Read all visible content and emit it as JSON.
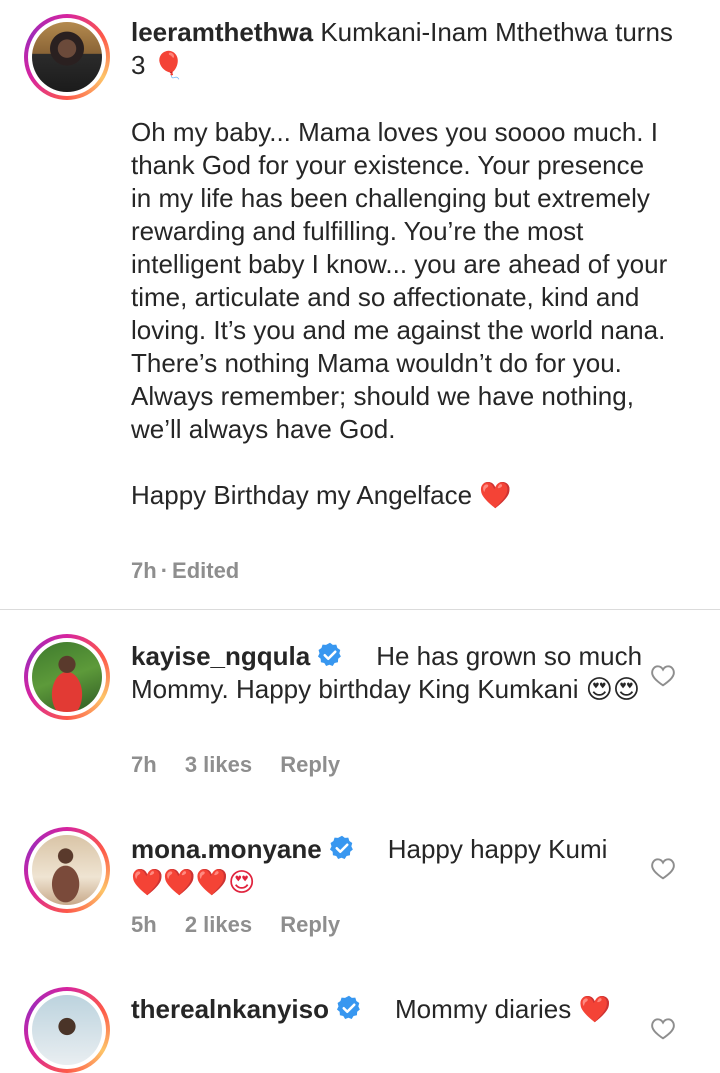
{
  "post": {
    "username": "leeramthethwa",
    "title_text": "Kumkani-Inam Mthethwa turns 3",
    "title_emoji": "🎈",
    "body": "Oh my baby... Mama loves you soooo much. I thank God for your existence. Your presence in my life has been challenging but extremely rewarding and fulfilling. You’re the most intelligent baby I know... you are ahead of your time, articulate and so affectionate, kind and loving. It’s you and me against the world nana. There’s nothing Mama wouldn’t do for you. Always remember; should we have nothing, we’ll always have God.",
    "closing": "Happy Birthday my Angelface",
    "closing_emoji": "❤️",
    "time": "7h",
    "edited": "Edited",
    "separator": "·"
  },
  "comments": [
    {
      "username": "kayise_ngqula",
      "verified": true,
      "text": "He has grown so much Mommy. Happy birthday King Kumkani",
      "emoji": "😍😍",
      "time": "7h",
      "likes": "3 likes",
      "reply": "Reply"
    },
    {
      "username": "mona.monyane",
      "verified": true,
      "text": "Happy happy Kumi",
      "emoji": "❤️❤️❤️😍",
      "time": "5h",
      "likes": "2 likes",
      "reply": "Reply"
    },
    {
      "username": "therealnkanyiso",
      "verified": true,
      "text": "Mommy diaries",
      "emoji": "❤️"
    }
  ],
  "icons": {
    "like": "heart-outline-icon",
    "verified": "verified-badge-icon",
    "brand_blue": "#3897f0"
  }
}
